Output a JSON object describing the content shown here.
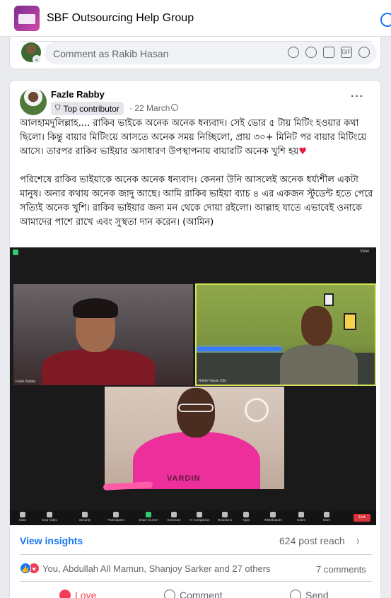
{
  "header": {
    "group_title": "SBF Outsourcing Help Group"
  },
  "comment_bar": {
    "placeholder": "Comment as Rakib Hasan",
    "icons": [
      "avatar-icon",
      "sticker-icon",
      "emoji-icon",
      "camera-icon",
      "gif-icon",
      "sticker-face-icon"
    ],
    "gif_label": "GIF"
  },
  "post": {
    "author": "Fazle Rabby",
    "badge": "Top contributor",
    "time": "22 March",
    "dot": "·",
    "more": "···",
    "paragraph1": "আলহামদুলিল্লাহ....  রাকিব ভাইকে অনেক অনেক ধন্যবাদ। সেই ভোর ৫ টায় মিটিং হওয়ার কথা ছিলো। কিন্তু বায়ার মিটিংয়ে আসতে অনেক সময় নিচ্ছিলো, প্রায় ৩০+ মিনিট পর বায়ার মিটিংয়ে আসে। তারপর রাকিব ভাইয়ার অসাধারণ উপস্থাপনায় বায়ারটি অনেক খুশি হয়",
    "paragraph1_heart": "♥",
    "paragraph2": "পরিশেষে রাকিব ভাইয়াকে অনেক অনেক ধন্যবাদ। কেননা উনি আসলেই অনেক ধর্য্যশীল একটা মানুষ। অনার কথায় অনেক জাদু আছে। আমি রাকিব ভাইয়া ব্যাচ ৪ এর একজন স্টুডেন্ট হতে পেরে সত্যিই অনেক খুশি। রাকিব ভাইয়ার জন্য মন থেকে দোয়া রইলো। আল্লাহ যাতে এভাবেই ওনাকে আমাদের পাশে রাখে এবং সুস্থতা দান করেন। (আমিন)"
  },
  "zoom": {
    "view_label": "View",
    "tile1_label": "Fazle Rabby",
    "tile2_label": "Rakib Hasan (Sir)",
    "hoodie_text": "VARDIN",
    "toolbar": [
      {
        "label": "Mute",
        "icon": "mic-icon"
      },
      {
        "label": "Stop Video",
        "icon": "video-icon"
      },
      {
        "label": "Security",
        "icon": "shield-icon"
      },
      {
        "label": "Participants",
        "icon": "people-icon"
      },
      {
        "label": "Share Screen",
        "icon": "share-screen-icon"
      },
      {
        "label": "Summary",
        "icon": "summary-icon"
      },
      {
        "label": "AI Companion",
        "icon": "sparkle-icon"
      },
      {
        "label": "Reactions",
        "icon": "smile-icon"
      },
      {
        "label": "Apps",
        "icon": "apps-icon"
      },
      {
        "label": "Whiteboards",
        "icon": "whiteboard-icon"
      },
      {
        "label": "Notes",
        "icon": "notes-icon"
      },
      {
        "label": "More",
        "icon": "more-icon"
      }
    ],
    "end_label": "End"
  },
  "insights": {
    "link": "View insights",
    "reach": "624 post reach",
    "chevron": "›"
  },
  "reactions": {
    "names": "You, Abdullah All Mamun, Shanjoy Sarker and 27 others",
    "comments": "7 comments",
    "like_glyph": "👍",
    "love_glyph": "♥"
  },
  "actions": {
    "love": "Love",
    "comment": "Comment",
    "send": "Send"
  },
  "colors": {
    "accent": "#1877f2",
    "love": "#f33e58",
    "muted": "#65676b"
  }
}
